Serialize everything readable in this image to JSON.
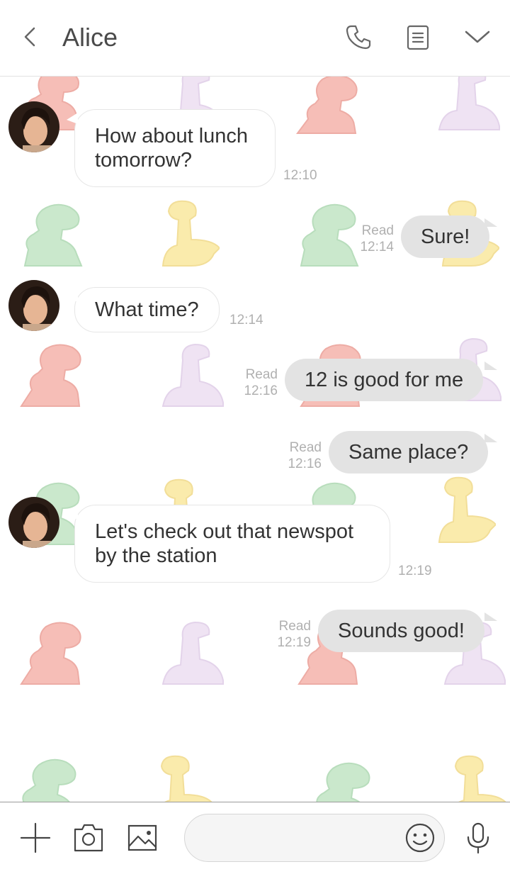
{
  "header": {
    "title": "Alice",
    "back_icon": "chevron-left-icon",
    "call_icon": "phone-icon",
    "notes_icon": "note-icon",
    "menu_icon": "chevron-down-icon"
  },
  "messages": [
    {
      "sender": "Alice",
      "direction": "incoming",
      "lines": [
        "How about lunch",
        "tomorrow?"
      ],
      "time": "12:10"
    },
    {
      "direction": "outgoing",
      "text": "Sure!",
      "read": "Read",
      "time": "12:14"
    },
    {
      "sender": "Alice",
      "direction": "incoming",
      "lines": [
        "What time?"
      ],
      "time": "12:14"
    },
    {
      "direction": "outgoing",
      "text": "12 is good for me",
      "read": "Read",
      "time": "12:16"
    },
    {
      "direction": "outgoing",
      "text": "Same place?",
      "read": "Read",
      "time": "12:16"
    },
    {
      "sender": "Alice",
      "direction": "incoming",
      "lines": [
        "Let's check out that newspot",
        "by the station"
      ],
      "time": "12:19"
    },
    {
      "direction": "outgoing",
      "text": "Sounds good!",
      "read": "Read",
      "time": "12:19"
    }
  ],
  "composer": {
    "placeholder": "",
    "add_icon": "plus-icon",
    "camera_icon": "camera-icon",
    "gallery_icon": "image-icon",
    "emoji_icon": "smiley-icon",
    "voice_icon": "microphone-icon"
  },
  "colors": {
    "incoming_bubble": "#ffffff",
    "outgoing_bubble": "#e3e3e3",
    "header_text": "#4a4a4a",
    "time_text": "#b0b0b0",
    "dino_red": "#f08a7e",
    "dino_purple": "#e2cdea",
    "dino_green": "#9fd6a3",
    "dino_yellow": "#f7db6a"
  }
}
